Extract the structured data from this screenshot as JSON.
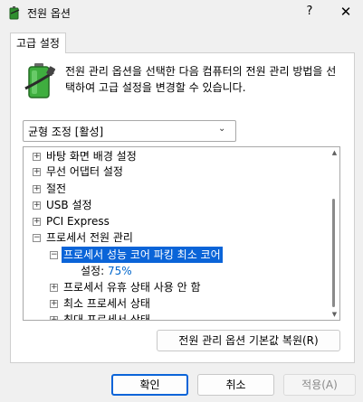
{
  "window": {
    "title": "전원 옵션",
    "help_label": "?",
    "close_label": "✕"
  },
  "tab": {
    "label": "고급 설정"
  },
  "description": "전원 관리 옵션을 선택한 다음 컴퓨터의 전원 관리 방법을 선택하여 고급 설정을 변경할 수 있습니다.",
  "plan_dropdown": {
    "selected": "균형 조정 [활성]"
  },
  "tree": {
    "items": [
      {
        "label": "바탕 화면 배경 설정",
        "expander": "+"
      },
      {
        "label": "무선 어댑터 설정",
        "expander": "+"
      },
      {
        "label": "절전",
        "expander": "+"
      },
      {
        "label": "USB 설정",
        "expander": "+"
      },
      {
        "label": "PCI Express",
        "expander": "+"
      },
      {
        "label": "프로세서 전원 관리",
        "expander": "−"
      },
      {
        "label": "프로세서 성능 코어 파킹 최소 코어",
        "expander": "−"
      },
      {
        "label": "설정:",
        "value": "75%"
      },
      {
        "label": "프로세서 유휴 상태 사용 안 함",
        "expander": "+"
      },
      {
        "label": "최소 프로세서 상태",
        "expander": "+"
      },
      {
        "label": "최대 프로세서 상태",
        "expander": "+"
      }
    ]
  },
  "buttons": {
    "restore": "전원 관리 옵션 기본값 복원(R)",
    "ok": "확인",
    "cancel": "취소",
    "apply": "적용(A)"
  },
  "colors": {
    "selection": "#0a64d8",
    "value_text": "#0066cc",
    "battery_green": "#3fae3f"
  }
}
